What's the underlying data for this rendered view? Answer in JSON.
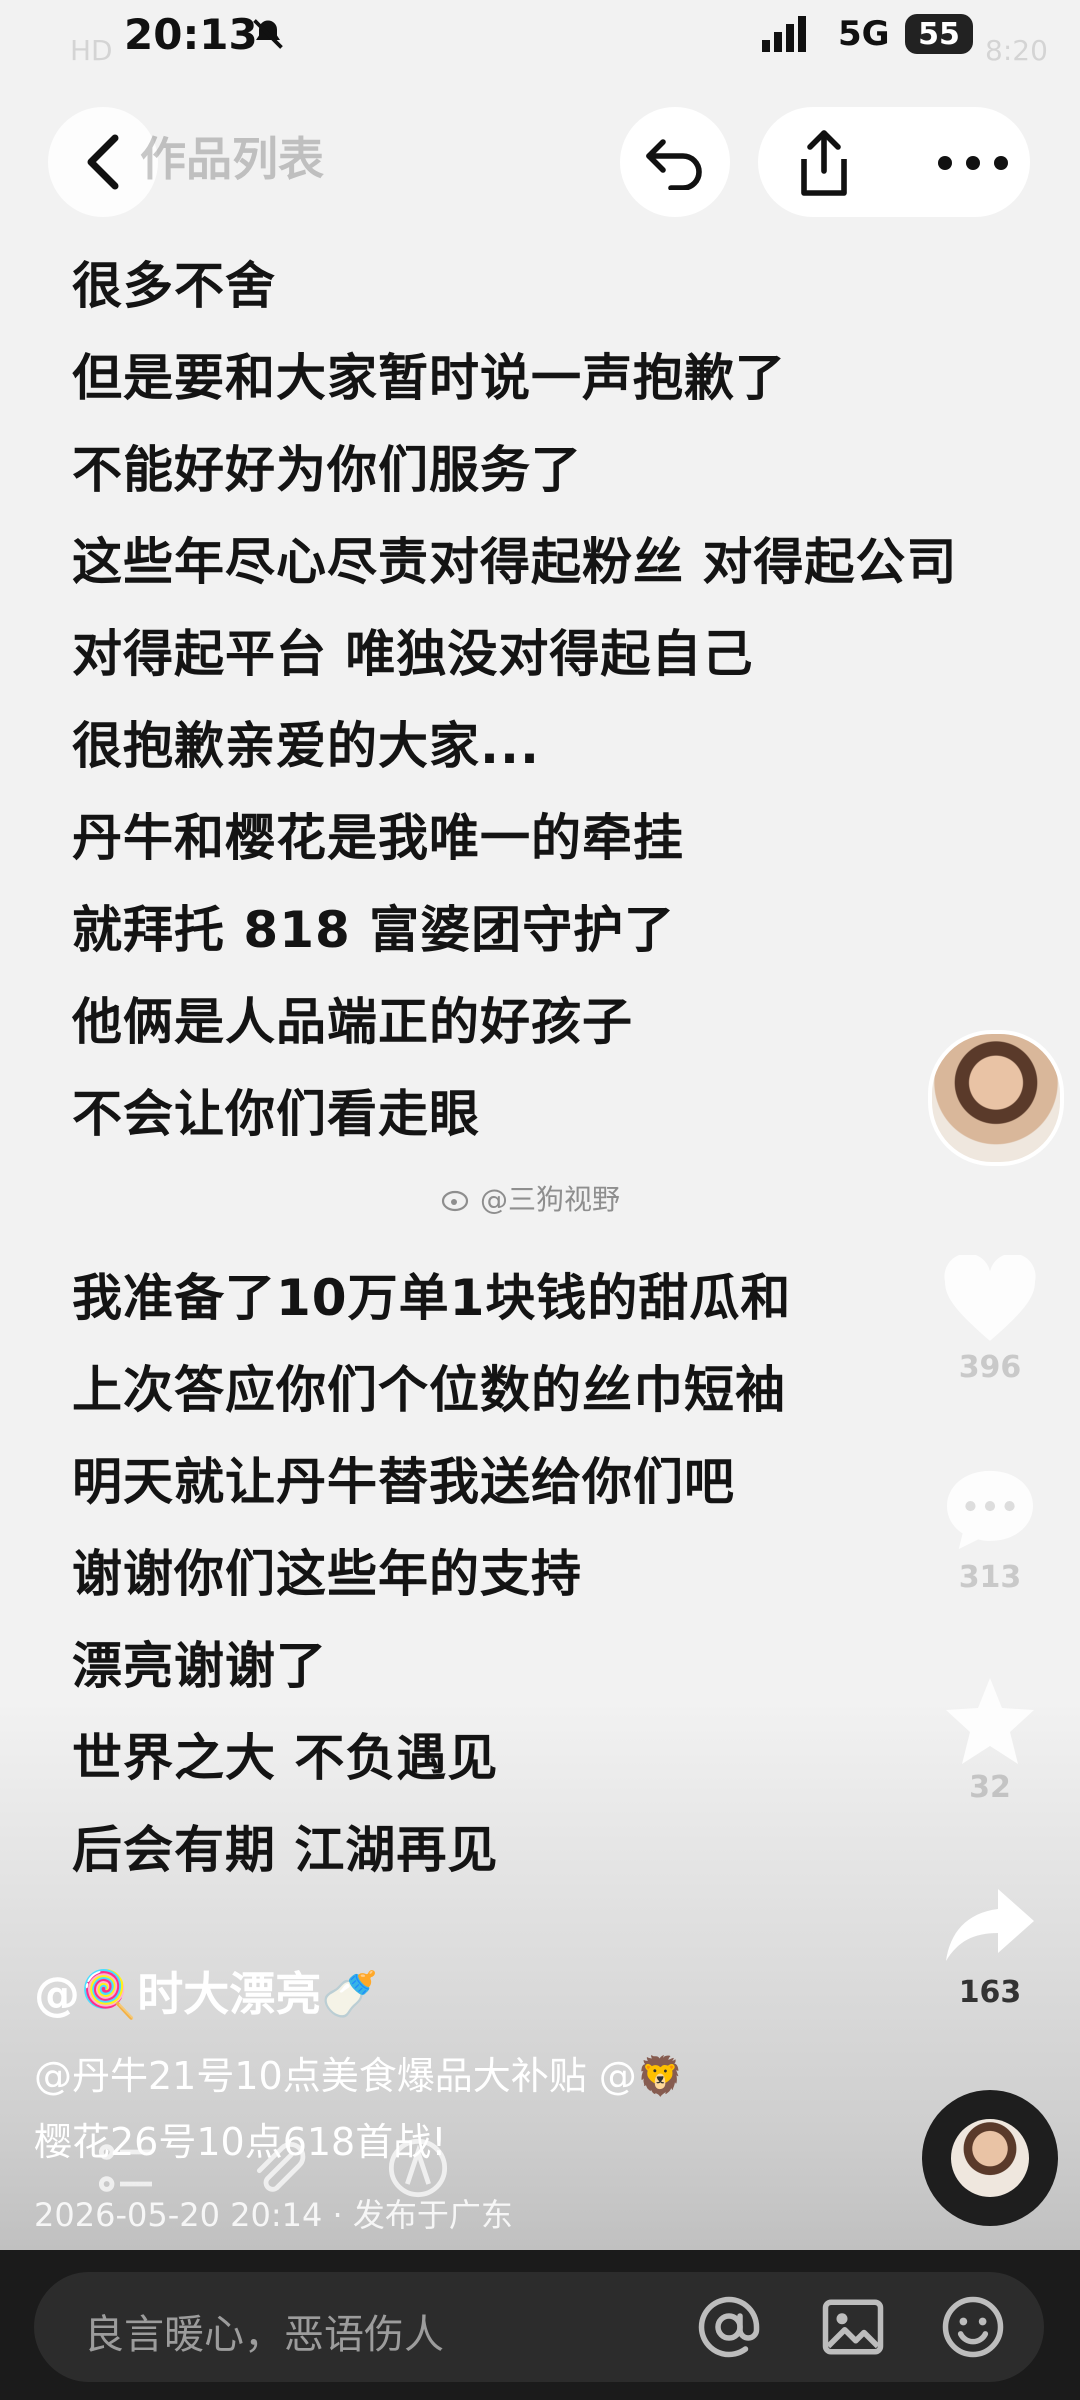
{
  "status_bar": {
    "time": "20:13",
    "network": "5G",
    "battery": "55",
    "ghost_time": "8:20",
    "ghost_left": "HD"
  },
  "nav": {
    "title": "作品列表"
  },
  "post": {
    "lines": [
      "很多不舍",
      "但是要和大家暂时说一声抱歉了",
      "不能好好为你们服务了",
      "这些年尽心尽责对得起粉丝 对得起公司",
      "对得起平台 唯独没对得起自己",
      "很抱歉亲爱的大家...",
      "丹牛和樱花是我唯一的牵挂",
      "就拜托 818 富婆团守护了",
      "他俩是人品端正的好孩子",
      "不会让你们看走眼",
      "",
      "我准备了10万单1块钱的甜瓜和",
      "上次答应你们个位数的丝巾短袖",
      "明天就让丹牛替我送给你们吧",
      "谢谢你们这些年的支持",
      "漂亮谢谢了",
      "世界之大 不负遇见",
      "后会有期 江湖再见"
    ],
    "watermark": "@三狗视野"
  },
  "rail": {
    "likes": "396",
    "comments": "313",
    "favorites": "32",
    "shares": "163"
  },
  "caption": {
    "author": "@🍭时大漂亮🍼",
    "desc_line1": "@丹牛21号10点美食爆品大补贴 @🦁",
    "desc_line2": "樱花26号10点618首战!",
    "meta": "2026-05-20 20:14 · 发布于广东"
  },
  "comment_bar": {
    "placeholder": "良言暖心，恶语伤人"
  },
  "colors": {
    "text": "#141414",
    "comment_bg": "#1b1b1b",
    "comment_box": "#2c2c2c"
  }
}
